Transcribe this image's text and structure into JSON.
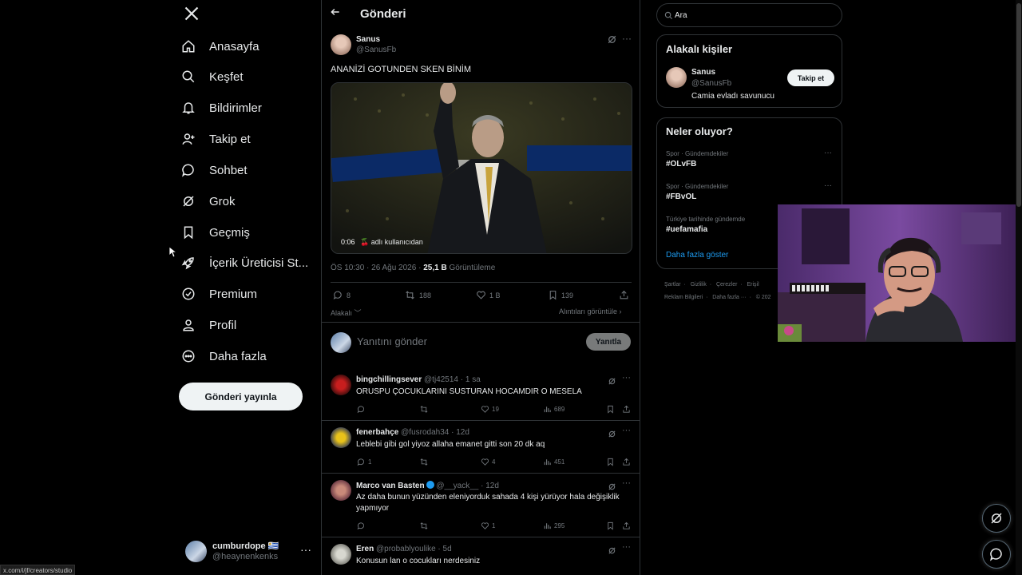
{
  "nav": {
    "items": [
      {
        "label": "Anasayfa",
        "icon": "home-icon"
      },
      {
        "label": "Keşfet",
        "icon": "search-icon"
      },
      {
        "label": "Bildirimler",
        "icon": "bell-icon"
      },
      {
        "label": "Takip et",
        "icon": "person-add-icon"
      },
      {
        "label": "Sohbet",
        "icon": "chat-bubble-icon"
      },
      {
        "label": "Grok",
        "icon": "grok-icon"
      },
      {
        "label": "Geçmiş",
        "icon": "bookmark-icon"
      },
      {
        "label": "İçerik Üreticisi St...",
        "icon": "rocket-icon"
      },
      {
        "label": "Premium",
        "icon": "verified-badge-icon"
      },
      {
        "label": "Profil",
        "icon": "person-icon"
      },
      {
        "label": "Daha fazla",
        "icon": "more-circle-icon"
      }
    ],
    "post_button": "Gönderi yayınla",
    "user": {
      "name": "cumburdope 🇺🇾",
      "handle": "@heaynenkenks"
    }
  },
  "status_url": "x.com/i/jf/creators/studio",
  "header": {
    "title": "Gönderi"
  },
  "post": {
    "author_name": "Sanus",
    "author_handle": "@SanusFb",
    "text": "ANANİZİ GOTUNDEN SKEN BİNİM",
    "video_duration": "0:06",
    "video_attribution": "🍒 adlı kullanıcıdan",
    "time": "ÖS 10:30 · 26 Ağu 2026 · ",
    "views_value": "25,1 B",
    "views_label": " Görüntüleme",
    "replies": "8",
    "reposts": "188",
    "likes": "1 B",
    "bookmarks": "139",
    "sort_label": "Alakalı",
    "quotes_label": "Alıntıları görüntüle"
  },
  "reply_box": {
    "placeholder": "Yanıtını gönder",
    "button": "Yanıtla"
  },
  "replies": [
    {
      "name": "bingchillingsever",
      "handle": "@tj42514",
      "time": "1 sa",
      "text": "ORUSPU ÇOCUKLARINI SUSTURAN HOCAMDIR O MESELA",
      "replies": "",
      "reposts": "",
      "likes": "19",
      "views": "689"
    },
    {
      "name": "fenerbahçe",
      "handle": "@fusrodah34",
      "time": "12d",
      "text": "Leblebi gibi gol yiyoz allaha emanet gitti son 20 dk aq",
      "replies": "1",
      "reposts": "",
      "likes": "4",
      "views": "451"
    },
    {
      "name": "Marco van Basten",
      "handle": "@__yack__",
      "time": "12d",
      "text": "Az daha bunun yüzünden eleniyorduk sahada 4 kişi yürüyor hala değişiklik yapmıyor",
      "replies": "",
      "reposts": "",
      "likes": "1",
      "views": "295"
    },
    {
      "name": "Eren",
      "handle": "@probablyoulike",
      "time": "5d",
      "text": "Konusun lan o cocukları nerdesiniz"
    }
  ],
  "search": {
    "value": "Ara"
  },
  "related": {
    "title": "Alakalı kişiler",
    "name": "Sanus",
    "handle": "@SanusFb",
    "bio": "Camia evladı savunucu",
    "follow": "Takip et"
  },
  "trends": {
    "title": "Neler oluyor?",
    "items": [
      {
        "category": "Spor · Gündemdekiler",
        "tag": "#OLvFB"
      },
      {
        "category": "Spor · Gündemdekiler",
        "tag": "#FBvOL"
      },
      {
        "category": "Türkiye tarihinde gündemde",
        "tag": "#uefamafia"
      }
    ],
    "show_more": "Daha fazla göster"
  },
  "footer": {
    "line1": [
      "Şartlar",
      "Gizlilik",
      "Çerezler",
      "Erişil"
    ],
    "line2": [
      "Reklam Bilgileri",
      "Daha fazla ···",
      "© 202"
    ]
  },
  "colors": {
    "accent": "#1d9bf0",
    "background": "#000000",
    "border": "#2f3336",
    "muted": "#71767b",
    "text": "#e7e9ea"
  }
}
